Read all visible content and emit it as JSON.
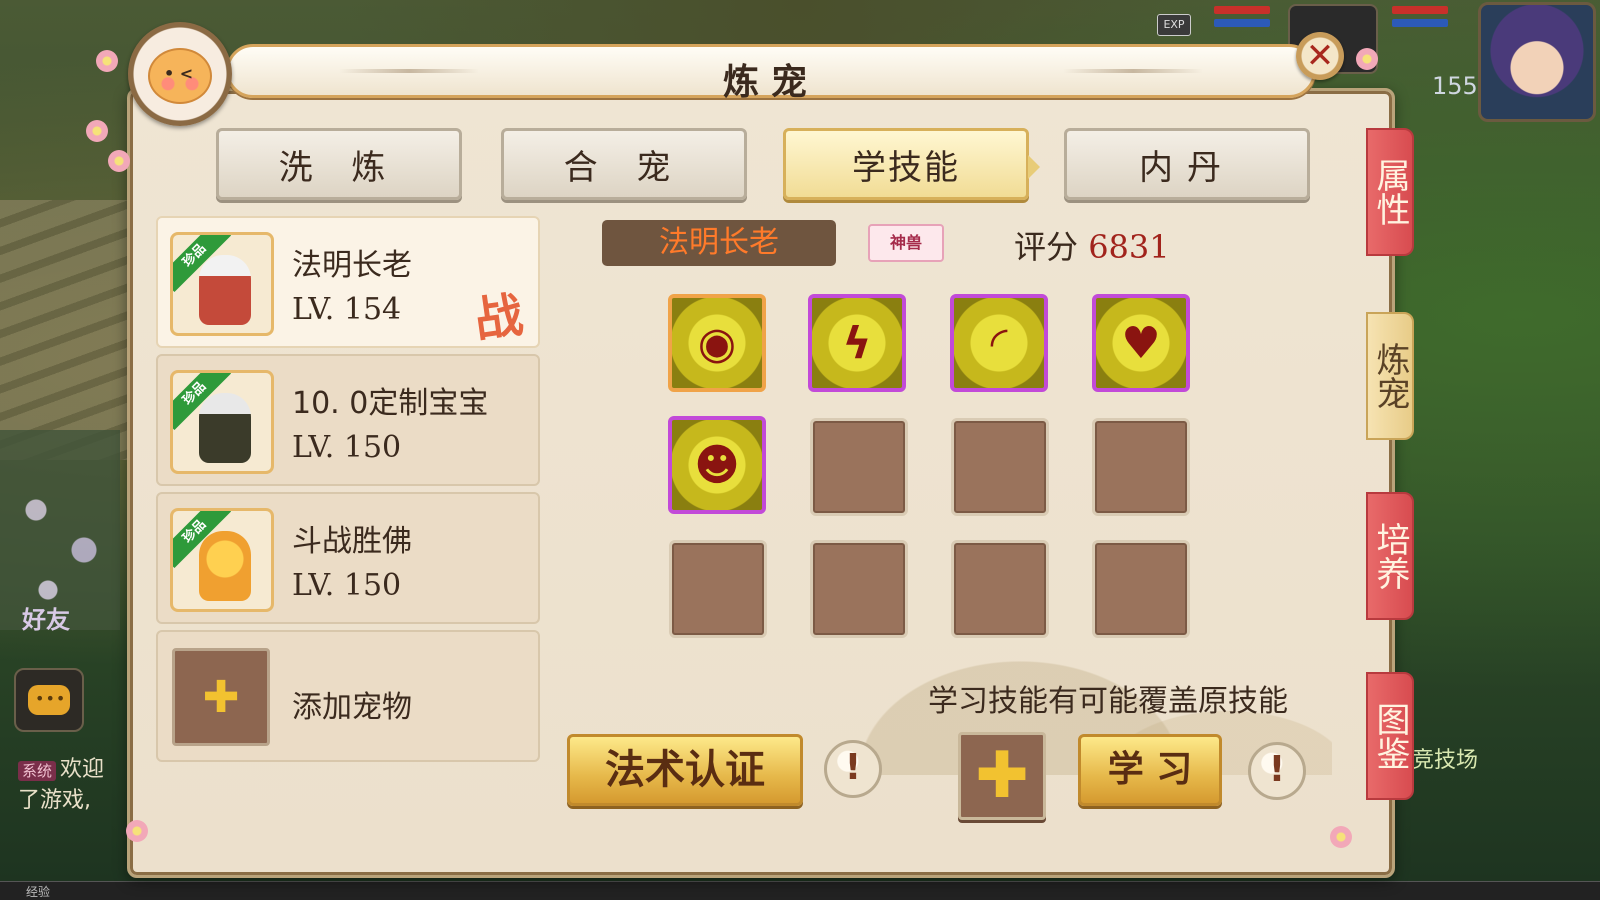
{
  "window": {
    "title": "炼宠",
    "close_icon": "close-x-icon"
  },
  "tabs": [
    {
      "label": "洗 炼",
      "active": false
    },
    {
      "label": "合 宠",
      "active": false
    },
    {
      "label": "学技能",
      "active": true
    },
    {
      "label": "内丹",
      "active": false
    }
  ],
  "side_tabs": [
    {
      "label": "属性",
      "active": false
    },
    {
      "label": "炼宠",
      "active": true
    },
    {
      "label": "培养",
      "active": false
    },
    {
      "label": "图鉴",
      "active": false
    }
  ],
  "pets": [
    {
      "name": "法明长老",
      "level": "LV. 154",
      "badge": "珍品",
      "status_mark": "战",
      "selected": true
    },
    {
      "name": "10. 0定制宝宝",
      "level": "LV. 150",
      "badge": "珍品",
      "selected": false
    },
    {
      "name": "斗战胜佛",
      "level": "LV. 150",
      "badge": "珍品",
      "selected": false
    }
  ],
  "add_pet": {
    "label": "添加宠物",
    "icon": "plus-icon"
  },
  "selected_pet": {
    "name": "法明长老",
    "tag": "神兽",
    "score_label": "评分",
    "score_value": "6831"
  },
  "skills": [
    {
      "icon": "eye-sigil-icon",
      "frame": "gold"
    },
    {
      "icon": "lightning-burst-icon",
      "frame": "purple"
    },
    {
      "icon": "signal-waves-icon",
      "frame": "purple"
    },
    {
      "icon": "heart-crest-icon",
      "frame": "purple"
    },
    {
      "icon": "mind-head-icon",
      "frame": "purple"
    }
  ],
  "empty_slot_count": 7,
  "warning_text": "学习技能有可能覆盖原技能",
  "buttons": {
    "spell_cert": "法术认证",
    "learn": "学 习",
    "info": "!"
  },
  "background": {
    "friend_label": "好友",
    "chat_tag": "系统",
    "chat_line": "欢迎 了游戏,",
    "arena_label": "竞技场",
    "player_level": "155",
    "exp_label": "经验",
    "exp_badge": "EXP"
  },
  "colors": {
    "accent_gold": "#e6b84a",
    "side_tab_red": "#d84c50",
    "skill_frame_purple": "#c24ad8",
    "score_red": "#a1231c",
    "name_orange": "#ff7a2a"
  }
}
